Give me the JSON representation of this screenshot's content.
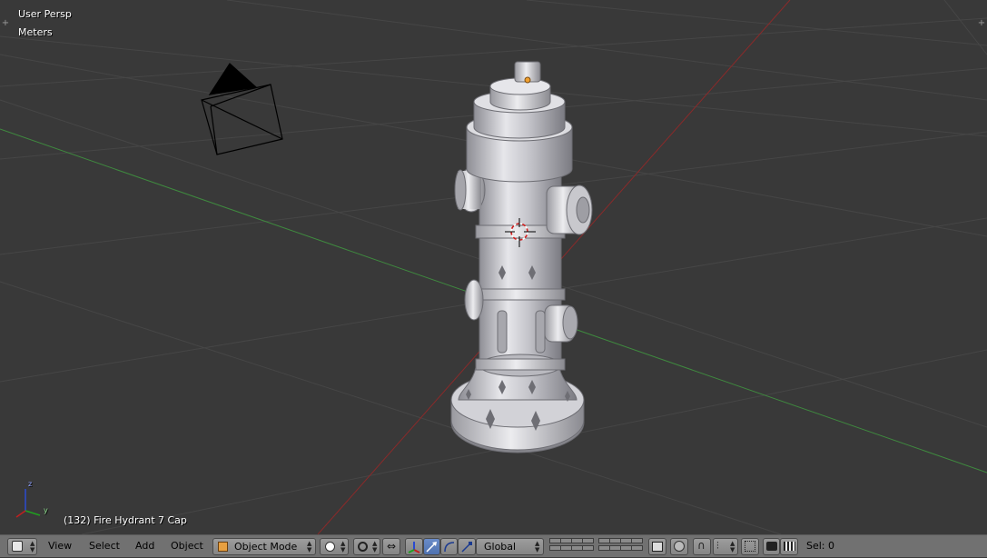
{
  "viewport": {
    "view_name": "User Persp",
    "units": "Meters",
    "object_info": "(132) Fire Hydrant 7 Cap",
    "axis_labels": {
      "z": "z",
      "y": "y"
    },
    "colors": {
      "background": "#393939",
      "x_axis": "#8a2a2a",
      "y_axis": "#3f8a3f",
      "grid": "#4a4a4a",
      "model": "#c9c9cf"
    }
  },
  "header": {
    "editor_type_icon": "3d-view-icon",
    "menus": [
      "View",
      "Select",
      "Add",
      "Object"
    ],
    "mode": {
      "icon": "object-mode-cube-icon",
      "label": "Object Mode"
    },
    "shading_icon": "solid-sphere-icon",
    "pivot_icon": "pivot-median-icon",
    "transform_orientation": "Global",
    "selection_info": "Sel: 0"
  }
}
